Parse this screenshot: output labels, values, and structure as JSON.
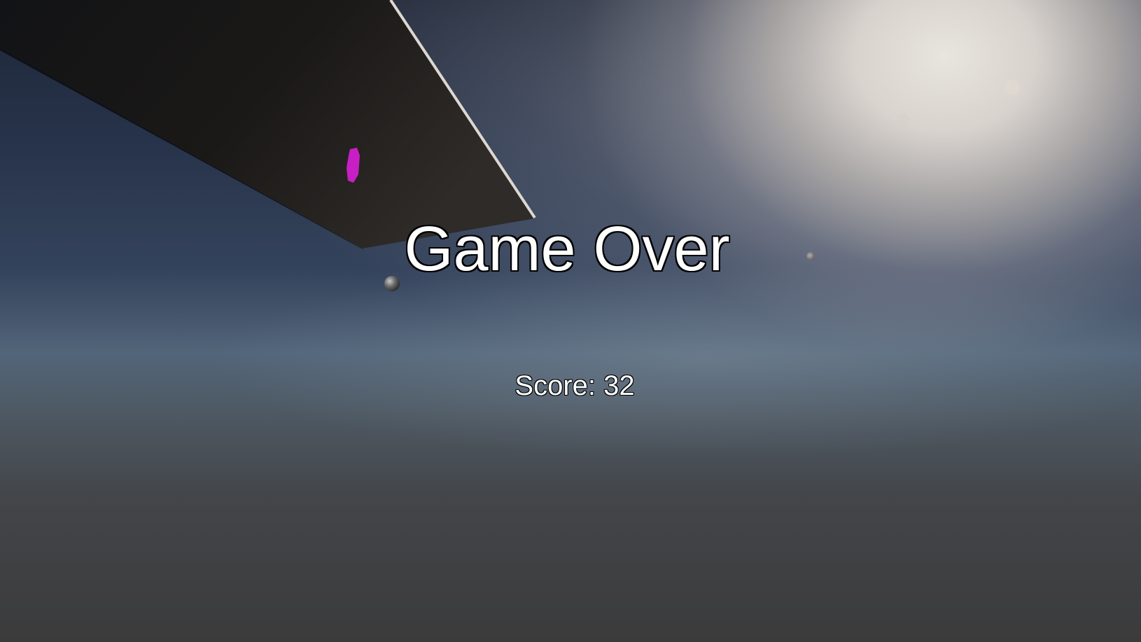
{
  "game_over": {
    "title": "Game Over",
    "score_text": "Score: 32"
  },
  "colors": {
    "marker": "#c81fc4",
    "platform": "#1a1816",
    "platform_edge": "#d8d4cc",
    "text": "#ffffff",
    "text_outline": "#000000"
  }
}
